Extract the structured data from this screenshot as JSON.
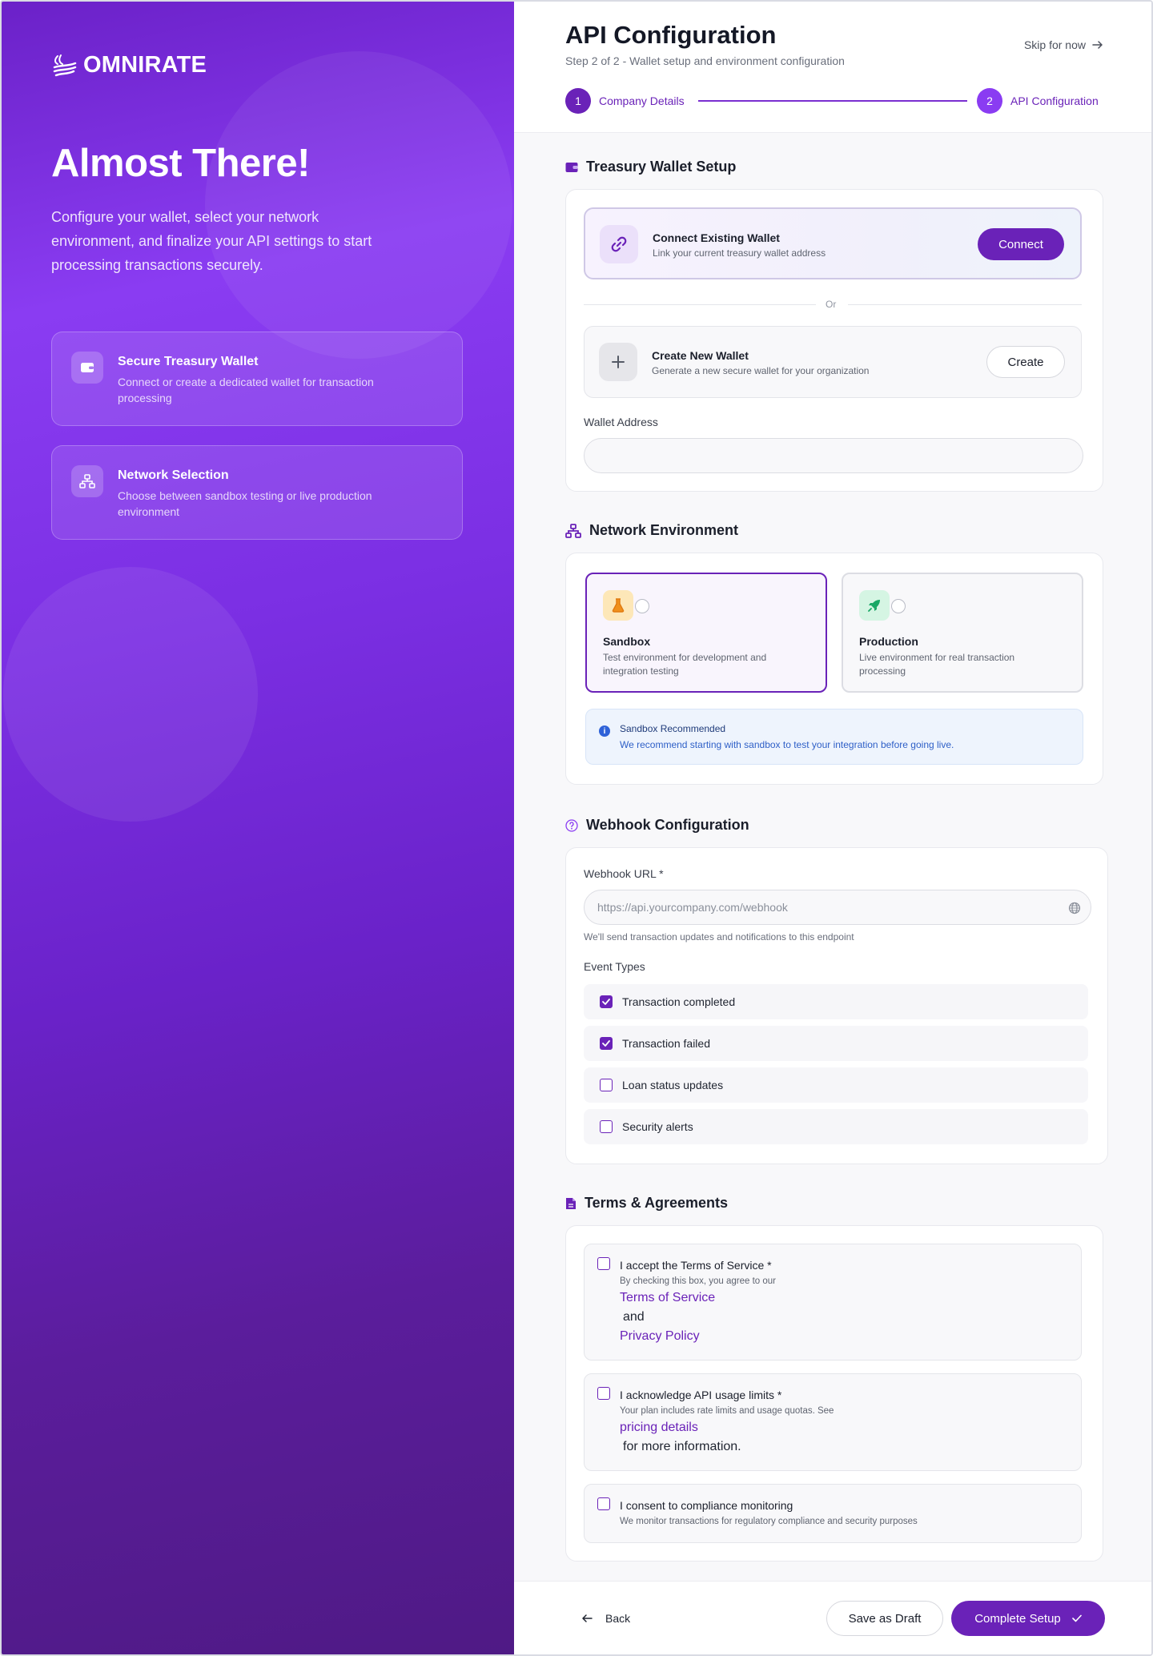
{
  "brand": {
    "name": "OMNIRATE"
  },
  "hero": {
    "title": "Almost There!",
    "subtitle": "Configure your wallet, select your network environment, and finalize your API settings to start processing transactions securely."
  },
  "features": [
    {
      "title": "Secure Treasury Wallet",
      "description": "Connect or create a dedicated wallet for transaction processing",
      "icon": "wallet-icon"
    },
    {
      "title": "Network Selection",
      "description": "Choose between sandbox testing or live production environment",
      "icon": "network-icon"
    }
  ],
  "header": {
    "title": "API Configuration",
    "subtitle": "Step 2 of 2 - Wallet setup and environment configuration",
    "skip_label": "Skip for now"
  },
  "stepper": [
    {
      "number": "1",
      "label": "Company Details"
    },
    {
      "number": "2",
      "label": "API Configuration"
    }
  ],
  "wallet": {
    "section_title": "Treasury Wallet Setup",
    "connect": {
      "title": "Connect Existing Wallet",
      "description": "Link your current treasury wallet address",
      "button": "Connect"
    },
    "or_label": "Or",
    "create": {
      "title": "Create New Wallet",
      "description": "Generate a new secure wallet for your organization",
      "button": "Create"
    },
    "address_label": "Wallet Address",
    "address_value": ""
  },
  "network": {
    "section_title": "Network Environment",
    "options": [
      {
        "title": "Sandbox",
        "description": "Test environment for development and integration testing",
        "icon": "flask-icon",
        "selected": true
      },
      {
        "title": "Production",
        "description": "Live environment for real transaction processing",
        "icon": "rocket-icon",
        "selected": false
      }
    ],
    "info_title": "Sandbox Recommended",
    "info_text": "We recommend starting with sandbox to test your integration before going live."
  },
  "webhook": {
    "section_title": "Webhook Configuration",
    "url_label": "Webhook URL *",
    "url_placeholder": "https://api.yourcompany.com/webhook",
    "url_hint": "We'll send transaction updates and notifications to this endpoint",
    "events_label": "Event Types",
    "events": [
      {
        "label": "Transaction completed",
        "checked": true
      },
      {
        "label": "Transaction failed",
        "checked": true
      },
      {
        "label": "Loan status updates",
        "checked": false
      },
      {
        "label": "Security alerts",
        "checked": false
      }
    ]
  },
  "terms": {
    "section_title": "Terms & Agreements",
    "items": [
      {
        "title": "I accept the Terms of Service *",
        "description": "By checking this box, you agree to our",
        "link1": "Terms of Service",
        "joiner": "and",
        "link2": "Privacy Policy"
      },
      {
        "title": "I acknowledge API usage limits *",
        "description": "Your plan includes rate limits and usage quotas. See",
        "link": "pricing details",
        "suffix": "for more information."
      },
      {
        "title": "I consent to compliance monitoring",
        "description": "We monitor transactions for regulatory compliance and security purposes"
      }
    ]
  },
  "footer": {
    "back_label": "Back",
    "draft_label": "Save as Draft",
    "complete_label": "Complete Setup"
  },
  "colors": {
    "primary": "#6a22b8",
    "accent": "#8a3cf2"
  }
}
